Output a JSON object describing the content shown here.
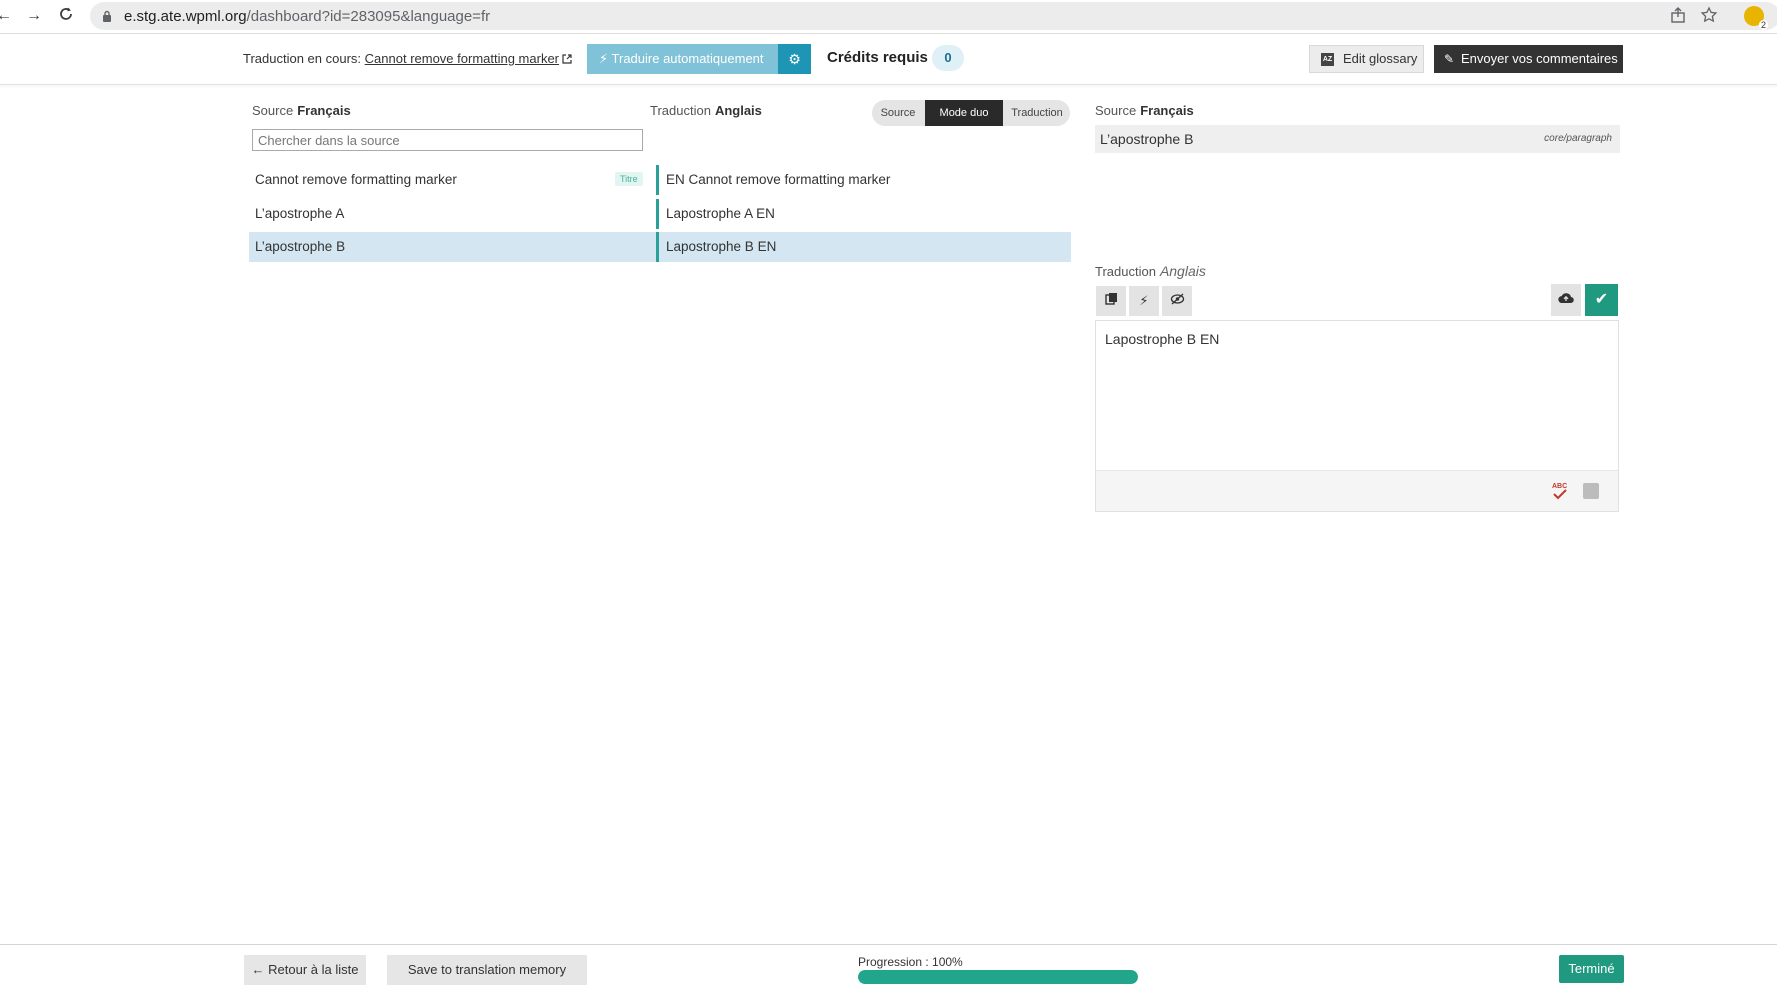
{
  "browser": {
    "url_host": "e.stg.ate.wpml.org",
    "url_path": "/dashboard?id=283095&language=fr",
    "extension_badge": "2"
  },
  "header": {
    "inprogress_label": "Traduction en cours:",
    "inprogress_link": "Cannot remove formatting marker",
    "auto_translate_label": "Traduire automatiquement",
    "credits_label": "Crédits requis",
    "credits_value": "0",
    "glossary_label": "Edit glossary",
    "feedback_label": "Envoyer vos commentaires"
  },
  "segments": {
    "source_label": "Source",
    "source_lang": "Français",
    "target_label": "Traduction",
    "target_lang": "Anglais",
    "search_placeholder": "Chercher dans la source",
    "modes": {
      "source": "Source",
      "duo": "Mode duo",
      "translation": "Traduction"
    },
    "rows": [
      {
        "source": "Cannot remove formatting marker",
        "tag": "Titre",
        "target": "EN Cannot remove formatting marker",
        "selected": false
      },
      {
        "source": "L’apostrophe A",
        "tag": "",
        "target": "Lapostrophe A EN",
        "selected": false
      },
      {
        "source": "L’apostrophe B",
        "tag": "",
        "target": "Lapostrophe B EN",
        "selected": true
      }
    ]
  },
  "editor": {
    "source_label": "Source",
    "source_lang": "Français",
    "source_text": "L’apostrophe B",
    "source_type": "core/paragraph",
    "target_label": "Traduction",
    "target_lang": "Anglais",
    "target_text": "Lapostrophe B EN"
  },
  "footer": {
    "back_label": "← Retour à la liste",
    "save_tm_label": "Save to translation memory",
    "progress_label": "Progression : 100%",
    "progress_value": 1.0,
    "done_label": "Terminé"
  },
  "colors": {
    "accent_teal": "#1f9a80",
    "auto_translate": "#80c2d8",
    "selected_row": "#d4e6f1"
  }
}
